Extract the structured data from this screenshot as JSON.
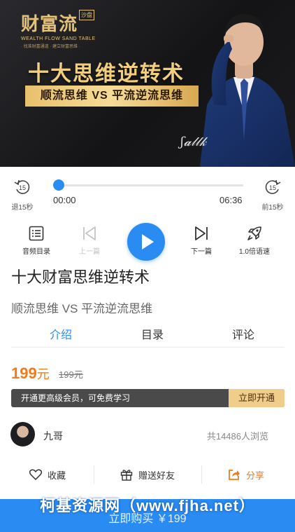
{
  "banner": {
    "brand_name": "财富流",
    "brand_badge": "沙盘",
    "brand_en": "WEALTH FLOW SAND TABLE",
    "brand_slogan": "· 找准财富通道 · 建立财富思维 ·",
    "title": "十大思维逆转术",
    "subtitle": "顺流思维 VS 平流逆流思维"
  },
  "player": {
    "back_label": "退15秒",
    "forward_label": "前15秒",
    "skip_seconds": "15",
    "current_time": "00:00",
    "total_time": "06:36",
    "progress": 0.0
  },
  "controls": {
    "list_label": "音频目录",
    "prev_label": "上一篇",
    "next_label": "下一篇",
    "speed_label": "1.0倍语速"
  },
  "course": {
    "title": "十大财富思维逆转术",
    "subtitle": "顺流思维 VS 平流逆流思维"
  },
  "tabs": [
    {
      "label": "介绍",
      "active": true
    },
    {
      "label": "目录",
      "active": false
    },
    {
      "label": "评论",
      "active": false
    }
  ],
  "price": {
    "current": "199",
    "unit": "元",
    "original": "199元"
  },
  "vip": {
    "text": "开通更高级会员，可免费学习",
    "button": "立即开通"
  },
  "author": {
    "name": "九哥",
    "views": "共14486人浏览"
  },
  "actions": {
    "favorite": "收藏",
    "gift": "赠送好友",
    "share": "分享"
  },
  "buy": {
    "label": "立即购买 ￥199",
    "watermark": "柯基资源网（www.fjha.net）"
  },
  "colors": {
    "accent": "#2a8bf2",
    "price": "#f07b1a",
    "gold": "#f1cd8c"
  }
}
